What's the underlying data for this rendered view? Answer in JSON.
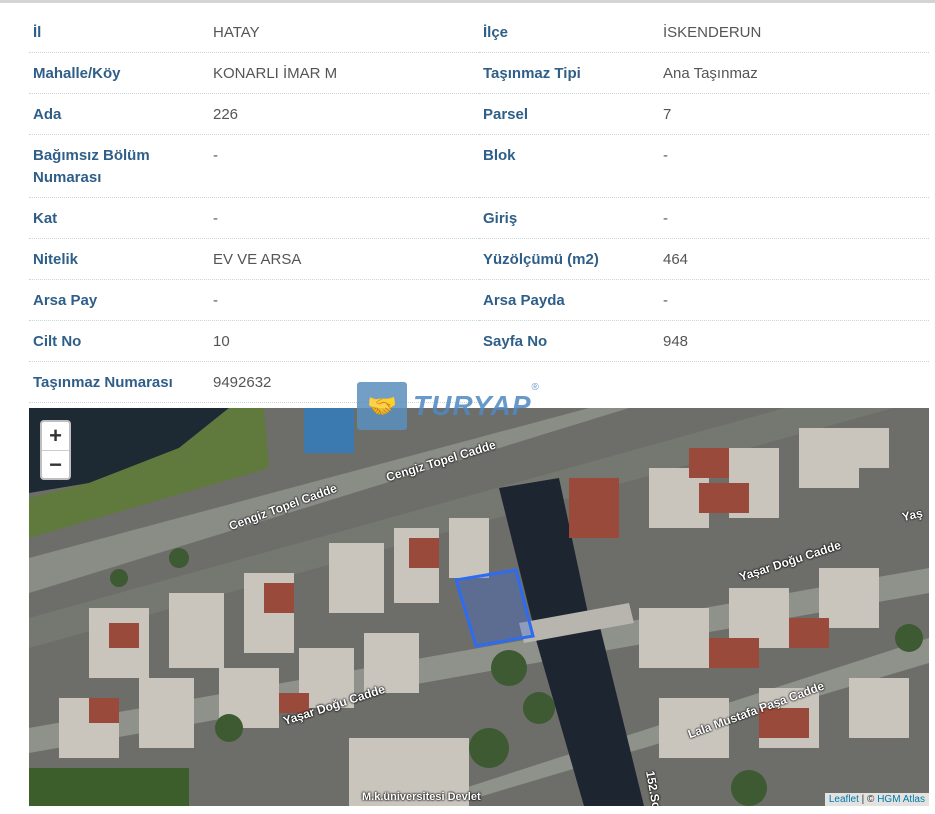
{
  "rows": [
    [
      {
        "label": "İl",
        "value": "HATAY"
      },
      {
        "label": "İlçe",
        "value": "İSKENDERUN"
      }
    ],
    [
      {
        "label": "Mahalle/Köy",
        "value": "KONARLI İMAR M"
      },
      {
        "label": "Taşınmaz Tipi",
        "value": "Ana Taşınmaz"
      }
    ],
    [
      {
        "label": "Ada",
        "value": "226"
      },
      {
        "label": "Parsel",
        "value": "7"
      }
    ],
    [
      {
        "label": "Bağımsız Bölüm Numarası",
        "value": "-"
      },
      {
        "label": "Blok",
        "value": "-"
      }
    ],
    [
      {
        "label": "Kat",
        "value": "-"
      },
      {
        "label": "Giriş",
        "value": "-"
      }
    ],
    [
      {
        "label": "Nitelik",
        "value": "EV VE ARSA"
      },
      {
        "label": "Yüzölçümü (m2)",
        "value": "464"
      }
    ],
    [
      {
        "label": "Arsa Pay",
        "value": "-"
      },
      {
        "label": "Arsa Payda",
        "value": "-"
      }
    ],
    [
      {
        "label": "Cilt No",
        "value": "10"
      },
      {
        "label": "Sayfa No",
        "value": "948"
      }
    ],
    [
      {
        "label": "Taşınmaz Numarası",
        "value": "9492632"
      }
    ]
  ],
  "map": {
    "zoom_in": "+",
    "zoom_out": "−",
    "attribution_leaflet": "Leaflet",
    "attribution_sep": " | © ",
    "attribution_hgm": "HGM Atlas",
    "streets": {
      "s1": "Cengiz Topel Cadde",
      "s2": "Cengiz Topel Cadde",
      "s3": "Yaşar Doğu Cadde",
      "s4": "Yaşar Doğu Cadde",
      "s5": "Lala Mustafa Paşa Cadde",
      "s6": "M.k.üniversitesi Devlet",
      "s7": "152.So",
      "s8": "Yaş"
    },
    "parcel_color": "#2d6cf0"
  },
  "logo": {
    "text": "TURYAP",
    "reg": "®"
  }
}
